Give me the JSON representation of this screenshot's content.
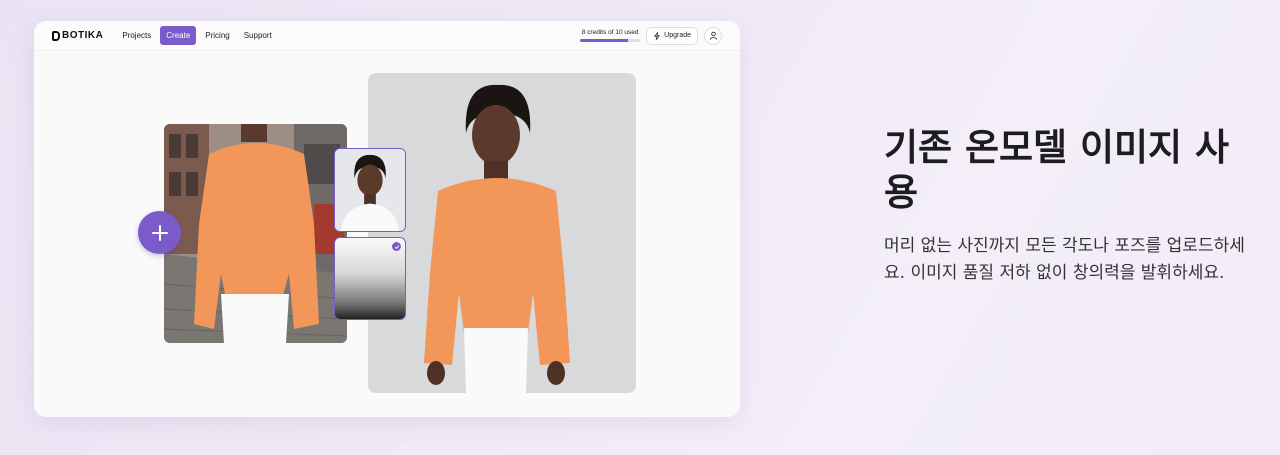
{
  "brand": {
    "name": "BOTIKA",
    "icon": "b-logo-icon"
  },
  "nav": {
    "items": [
      {
        "label": "Projects",
        "active": false
      },
      {
        "label": "Create",
        "active": true
      },
      {
        "label": "Pricing",
        "active": false
      },
      {
        "label": "Support",
        "active": false
      }
    ]
  },
  "credits": {
    "text": "8 credits of 10 used",
    "used": 8,
    "total": 10
  },
  "upgrade": {
    "label": "Upgrade",
    "icon": "lightning-icon"
  },
  "account": {
    "icon": "user-icon"
  },
  "canvas": {
    "add_icon": "plus-icon",
    "selected_icon": "checkmark-icon"
  },
  "promo": {
    "title": "기존 온모델 이미지 사용",
    "description": "머리 없는 사진까지 모든 각도나 포즈를 업로드하세요. 이미지 품질 저하 없이 창의력을 발휘하세요."
  },
  "colors": {
    "accent": "#7b5bc9",
    "sweater": "#f2965a",
    "background": "#efe9f6"
  }
}
